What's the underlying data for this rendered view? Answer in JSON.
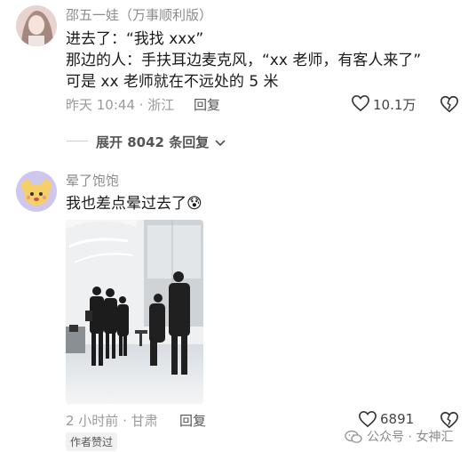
{
  "comment1": {
    "username": "邵五一娃（万事顺利版）",
    "lines": [
      "进去了：“我找 xxx”",
      "那边的人：手扶耳边麦克风，“xx 老师，有客人来了”",
      "可是 xx 老师就在不远处的 5 米"
    ],
    "time_location": "昨天 10:44 · 浙江",
    "reply_label": "回复",
    "like_count": "10.1万"
  },
  "expand_replies": {
    "label": "展开 8042 条回复"
  },
  "comment2": {
    "username": "晕了饱饱",
    "text": "我也差点晕过去了",
    "emoji": "😰",
    "time_location": "2 小时前 · 甘肃",
    "reply_label": "回复",
    "like_count": "6891",
    "author_badge": "作者赞过"
  },
  "watermark": {
    "text": "公众号 · 女神汇"
  },
  "colors": {
    "muted": "#8a8a8a",
    "text": "#1a1a1a",
    "heart_stroke": "#333333"
  }
}
